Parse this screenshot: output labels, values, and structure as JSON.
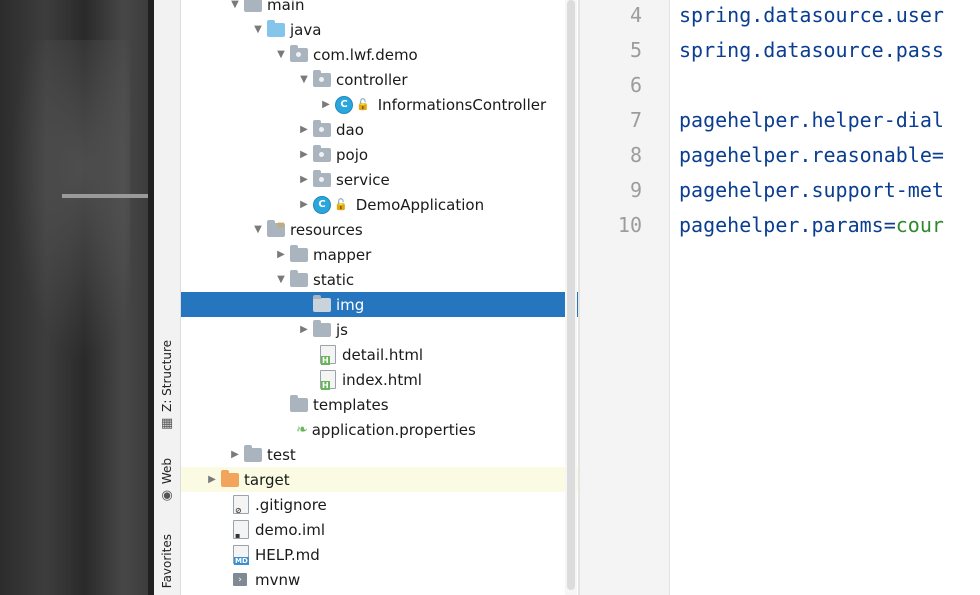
{
  "tool_tabs": [
    {
      "label": "Z: Structure",
      "icon": "structure-icon"
    },
    {
      "label": "Web",
      "icon": "globe-icon"
    },
    {
      "label": "Favorites",
      "icon": "star-icon"
    }
  ],
  "tree": [
    {
      "label": "main",
      "arrow": "down",
      "icon": "folder"
    },
    {
      "label": "java",
      "arrow": "down",
      "icon": "folder-source"
    },
    {
      "label": "com.lwf.demo",
      "arrow": "down",
      "icon": "package"
    },
    {
      "label": "controller",
      "arrow": "down",
      "icon": "package"
    },
    {
      "label": "InformationsController",
      "arrow": "right",
      "icon": "class"
    },
    {
      "label": "dao",
      "arrow": "right",
      "icon": "package"
    },
    {
      "label": "pojo",
      "arrow": "right",
      "icon": "package"
    },
    {
      "label": "service",
      "arrow": "right",
      "icon": "package"
    },
    {
      "label": "DemoApplication",
      "arrow": "right",
      "icon": "spring-class"
    },
    {
      "label": "resources",
      "arrow": "down",
      "icon": "folder-resources"
    },
    {
      "label": "mapper",
      "arrow": "right",
      "icon": "folder"
    },
    {
      "label": "static",
      "arrow": "down",
      "icon": "folder"
    },
    {
      "label": "img",
      "arrow": "none",
      "icon": "folder",
      "selected": true
    },
    {
      "label": "js",
      "arrow": "right",
      "icon": "folder"
    },
    {
      "label": "detail.html",
      "arrow": "none",
      "icon": "html-file"
    },
    {
      "label": "index.html",
      "arrow": "none",
      "icon": "html-file"
    },
    {
      "label": "templates",
      "arrow": "none",
      "icon": "folder"
    },
    {
      "label": "application.properties",
      "arrow": "none",
      "icon": "spring-properties"
    },
    {
      "label": "test",
      "arrow": "right",
      "icon": "folder"
    },
    {
      "label": "target",
      "arrow": "right",
      "icon": "folder-excluded"
    },
    {
      "label": ".gitignore",
      "arrow": "none",
      "icon": "ignore-file"
    },
    {
      "label": "demo.iml",
      "arrow": "none",
      "icon": "iml-file"
    },
    {
      "label": "HELP.md",
      "arrow": "none",
      "icon": "markdown-file"
    },
    {
      "label": "mvnw",
      "arrow": "none",
      "icon": "terminal-file"
    }
  ],
  "editor": {
    "lines": [
      {
        "num": "4",
        "key": "spring.datasource.user",
        "eq": "",
        "val": ""
      },
      {
        "num": "5",
        "key": "spring.datasource.pass",
        "eq": "",
        "val": ""
      },
      {
        "num": "6",
        "key": "",
        "eq": "",
        "val": ""
      },
      {
        "num": "7",
        "key": "pagehelper.helper-dial",
        "eq": "",
        "val": ""
      },
      {
        "num": "8",
        "key": "pagehelper.reasonable",
        "eq": "=",
        "val": ""
      },
      {
        "num": "9",
        "key": "pagehelper.support-met",
        "eq": "",
        "val": ""
      },
      {
        "num": "10",
        "key": "pagehelper.params",
        "eq": "=",
        "val": "cour"
      }
    ]
  },
  "colors": {
    "selection": "#2675bf",
    "highlight_row": "#fbfbe4",
    "code_key": "#0b3d91",
    "code_value": "#2f8a2f"
  }
}
